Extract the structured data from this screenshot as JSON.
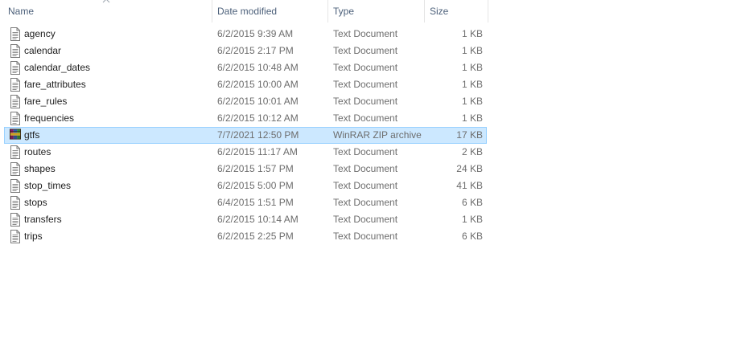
{
  "columns": {
    "name": "Name",
    "date": "Date modified",
    "type": "Type",
    "size": "Size"
  },
  "files": [
    {
      "name": "agency",
      "date": "6/2/2015 9:39 AM",
      "type": "Text Document",
      "size": "1 KB",
      "icon": "text-document-icon",
      "selected": false
    },
    {
      "name": "calendar",
      "date": "6/2/2015 2:17 PM",
      "type": "Text Document",
      "size": "1 KB",
      "icon": "text-document-icon",
      "selected": false
    },
    {
      "name": "calendar_dates",
      "date": "6/2/2015 10:48 AM",
      "type": "Text Document",
      "size": "1 KB",
      "icon": "text-document-icon",
      "selected": false
    },
    {
      "name": "fare_attributes",
      "date": "6/2/2015 10:00 AM",
      "type": "Text Document",
      "size": "1 KB",
      "icon": "text-document-icon",
      "selected": false
    },
    {
      "name": "fare_rules",
      "date": "6/2/2015 10:01 AM",
      "type": "Text Document",
      "size": "1 KB",
      "icon": "text-document-icon",
      "selected": false
    },
    {
      "name": "frequencies",
      "date": "6/2/2015 10:12 AM",
      "type": "Text Document",
      "size": "1 KB",
      "icon": "text-document-icon",
      "selected": false
    },
    {
      "name": "gtfs",
      "date": "7/7/2021 12:50 PM",
      "type": "WinRAR ZIP archive",
      "size": "17 KB",
      "icon": "winrar-archive-icon",
      "selected": true
    },
    {
      "name": "routes",
      "date": "6/2/2015 11:17 AM",
      "type": "Text Document",
      "size": "2 KB",
      "icon": "text-document-icon",
      "selected": false
    },
    {
      "name": "shapes",
      "date": "6/2/2015 1:57 PM",
      "type": "Text Document",
      "size": "24 KB",
      "icon": "text-document-icon",
      "selected": false
    },
    {
      "name": "stop_times",
      "date": "6/2/2015 5:00 PM",
      "type": "Text Document",
      "size": "41 KB",
      "icon": "text-document-icon",
      "selected": false
    },
    {
      "name": "stops",
      "date": "6/4/2015 1:51 PM",
      "type": "Text Document",
      "size": "6 KB",
      "icon": "text-document-icon",
      "selected": false
    },
    {
      "name": "transfers",
      "date": "6/2/2015 10:14 AM",
      "type": "Text Document",
      "size": "1 KB",
      "icon": "text-document-icon",
      "selected": false
    },
    {
      "name": "trips",
      "date": "6/2/2015 2:25 PM",
      "type": "Text Document",
      "size": "6 KB",
      "icon": "text-document-icon",
      "selected": false
    }
  ],
  "colors": {
    "header_text": "#4c607a",
    "selection_bg": "#cce8ff",
    "selection_border": "#99d1ff",
    "meta_text": "#6d6d6d"
  }
}
